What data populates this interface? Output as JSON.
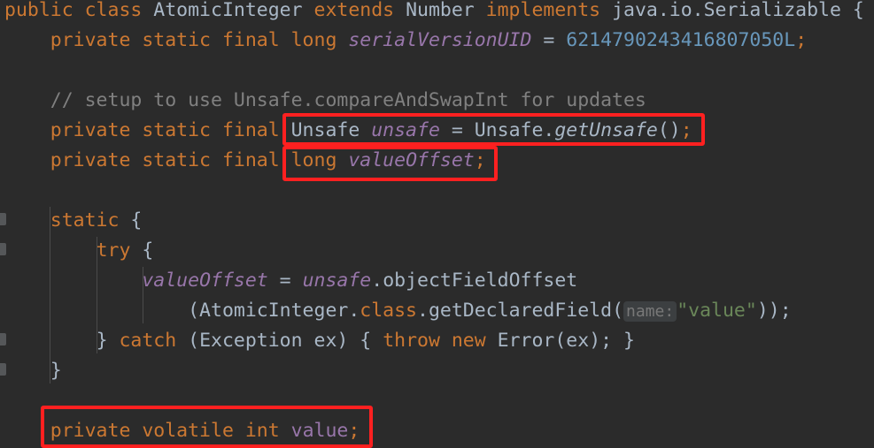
{
  "editor": {
    "theme_name": "darcula",
    "background": "#2b2b2b",
    "language": "java",
    "colors": {
      "keyword": "#cc7832",
      "identifier": "#a9b7c6",
      "number": "#6897bb",
      "string": "#6a8759",
      "comment": "#808080",
      "static_field": "#9876aa",
      "indent_guide": "#4b4b4b",
      "fold_marker": "#555759",
      "annotation_box": "#ff2020",
      "param_hint_text": "#787878",
      "param_hint_background": "#3c3f41"
    }
  },
  "code": {
    "line1": {
      "t1": "public ",
      "t2": "class ",
      "t3": "AtomicInteger ",
      "t4": "extends ",
      "t5": "Number ",
      "t6": "implements ",
      "t7": "java.io.Serializable {"
    },
    "line2": {
      "t1": "private static final ",
      "t2": "long ",
      "t3": "serialVersionUID",
      "t4": " = ",
      "t5": "6214790243416807050L",
      "t6": ";"
    },
    "line4": {
      "t1": "// setup to use Unsafe.compareAndSwapInt for updates"
    },
    "line5": {
      "t1": "private static final ",
      "t2": "Unsafe ",
      "t3": "unsafe",
      "t4": " = ",
      "t5": "Unsafe.",
      "t6": "getUnsafe",
      "t7": "()",
      "t8": ";"
    },
    "line6": {
      "t1": "private static final ",
      "t2": "long ",
      "t3": "valueOffset",
      "t4": ";"
    },
    "line8": {
      "t1": "static ",
      "t2": "{"
    },
    "line9": {
      "t1": "try ",
      "t2": "{"
    },
    "line10": {
      "t1": "valueOffset",
      "t2": " = ",
      "t3": "unsafe",
      "t4": ".objectFieldOffset"
    },
    "line11": {
      "t1": "(AtomicInteger.",
      "t2": "class",
      "t3": ".getDeclaredField(",
      "t4": "name:",
      "t5": "\"value\"",
      "t6": "));"
    },
    "line12": {
      "t1": "} ",
      "t2": "catch ",
      "t3": "(Exception ex) { ",
      "t4": "throw ",
      "t5": "new ",
      "t6": "Error(ex); }"
    },
    "line13": {
      "t1": "}"
    },
    "line15": {
      "t1": "private volatile ",
      "t2": "int ",
      "t3": "value",
      "t4": ";"
    }
  },
  "annotations": {
    "box1_label": "highlight-unsafe-declaration",
    "box2_label": "highlight-valueoffset-declaration",
    "box3_label": "highlight-volatile-value-field"
  }
}
